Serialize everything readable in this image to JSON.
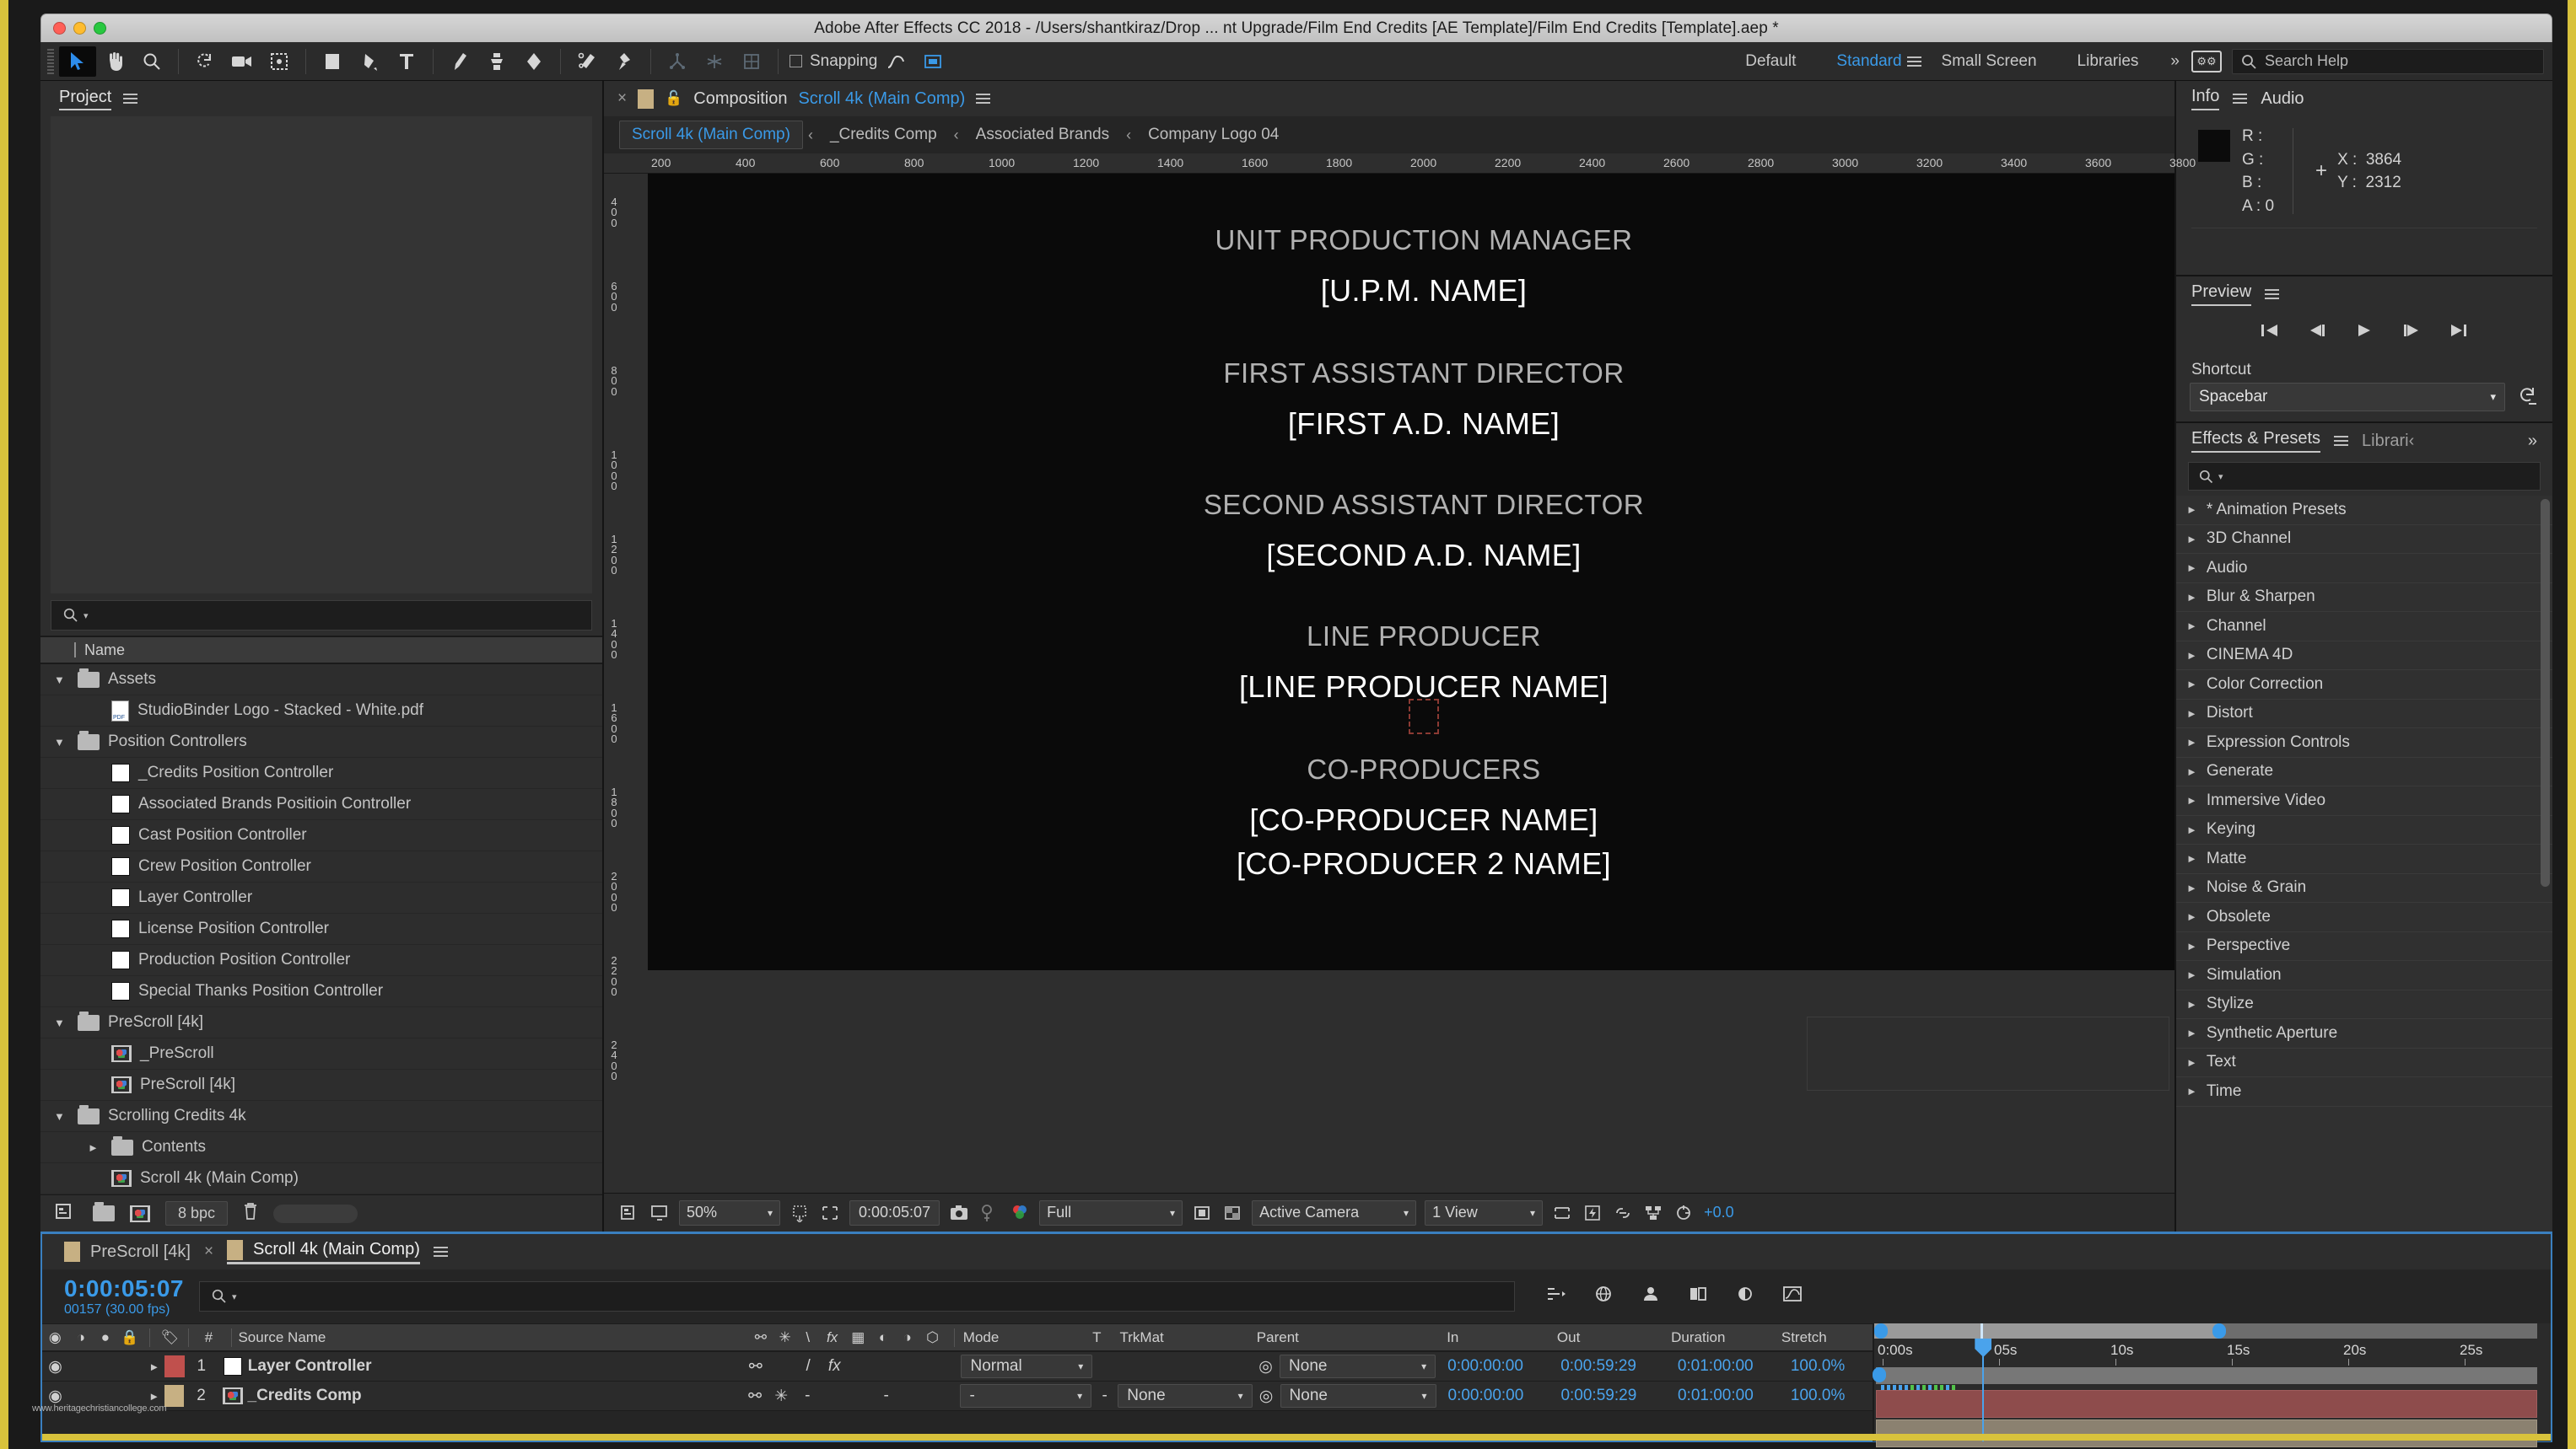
{
  "window": {
    "title": "Adobe After Effects CC 2018 - /Users/shantkiraz/Drop ... nt Upgrade/Film End Credits [AE Template]/Film End Credits [Template].aep *"
  },
  "toolbar": {
    "snapping_label": "Snapping",
    "workspaces": [
      {
        "label": "Default",
        "selected": false
      },
      {
        "label": "Standard",
        "selected": true
      },
      {
        "label": "Small Screen",
        "selected": false
      },
      {
        "label": "Libraries",
        "selected": false
      }
    ],
    "overflow": "»",
    "search_help_placeholder": "Search Help"
  },
  "project": {
    "title": "Project",
    "search_placeholder": "",
    "column_header": "Name",
    "items": [
      {
        "label": "Assets",
        "type": "folder",
        "depth": 0,
        "twirl": "down"
      },
      {
        "label": "StudioBinder Logo - Stacked - White.pdf",
        "type": "pdf",
        "depth": 1,
        "twirl": ""
      },
      {
        "label": "Position Controllers",
        "type": "folder",
        "depth": 0,
        "twirl": "down"
      },
      {
        "label": "_Credits Position Controller",
        "type": "solid",
        "depth": 1,
        "twirl": ""
      },
      {
        "label": "Associated Brands Positioin Controller",
        "type": "solid",
        "depth": 1,
        "twirl": ""
      },
      {
        "label": "Cast Position Controller",
        "type": "solid",
        "depth": 1,
        "twirl": ""
      },
      {
        "label": "Crew Position Controller",
        "type": "solid",
        "depth": 1,
        "twirl": ""
      },
      {
        "label": "Layer Controller",
        "type": "solid",
        "depth": 1,
        "twirl": ""
      },
      {
        "label": "License Position Controller",
        "type": "solid",
        "depth": 1,
        "twirl": ""
      },
      {
        "label": "Production Position Controller",
        "type": "solid",
        "depth": 1,
        "twirl": ""
      },
      {
        "label": "Special Thanks Position Controller",
        "type": "solid",
        "depth": 1,
        "twirl": ""
      },
      {
        "label": "PreScroll [4k]",
        "type": "folder",
        "depth": 0,
        "twirl": "down"
      },
      {
        "label": "_PreScroll",
        "type": "comp",
        "depth": 1,
        "twirl": ""
      },
      {
        "label": "PreScroll [4k]",
        "type": "comp",
        "depth": 1,
        "twirl": ""
      },
      {
        "label": "Scrolling Credits 4k",
        "type": "folder",
        "depth": 0,
        "twirl": "down"
      },
      {
        "label": "Contents",
        "type": "folder",
        "depth": 1,
        "twirl": "right"
      },
      {
        "label": "Scroll 4k (Main Comp)",
        "type": "comp",
        "depth": 1,
        "twirl": ""
      }
    ],
    "footer": {
      "bpc": "8 bpc"
    }
  },
  "composition": {
    "tab_label": "Composition",
    "tab_name": "Scroll 4k (Main Comp)",
    "breadcrumbs": [
      {
        "label": "Scroll 4k (Main Comp)",
        "active": true
      },
      {
        "label": "_Credits Comp",
        "active": false
      },
      {
        "label": "Associated Brands",
        "active": false
      },
      {
        "label": "Company Logo 04",
        "active": false
      }
    ],
    "ruler_h": [
      "200",
      "400",
      "600",
      "800",
      "1000",
      "1200",
      "1400",
      "1600",
      "1800",
      "2000",
      "2200",
      "2400",
      "2600",
      "2800",
      "3000",
      "3200",
      "3400",
      "3600",
      "3800"
    ],
    "ruler_v": [
      "400",
      "600",
      "800",
      "1000",
      "1200",
      "1400",
      "1600",
      "1800",
      "2000",
      "2200",
      "2400"
    ],
    "credits": [
      {
        "role": "UNIT PRODUCTION MANAGER",
        "names": [
          "[U.P.M. NAME]"
        ]
      },
      {
        "role": "FIRST ASSISTANT DIRECTOR",
        "names": [
          "[FIRST A.D. NAME]"
        ]
      },
      {
        "role": "SECOND ASSISTANT DIRECTOR",
        "names": [
          "[SECOND A.D. NAME]"
        ]
      },
      {
        "role": "LINE PRODUCER",
        "names": [
          "[LINE PRODUCER NAME]"
        ]
      },
      {
        "role": "CO-PRODUCERS",
        "names": [
          "[CO-PRODUCER NAME]",
          "[CO-PRODUCER 2 NAME]"
        ]
      }
    ],
    "footer": {
      "zoom": "50%",
      "time": "0:00:05:07",
      "resolution": "Full",
      "camera": "Active Camera",
      "views": "1 View",
      "exposure": "+0.0"
    }
  },
  "info_panel": {
    "tabs": [
      {
        "label": "Info",
        "selected": true
      },
      {
        "label": "Audio",
        "selected": false
      }
    ],
    "r_label": "R :",
    "r_value": "",
    "g_label": "G :",
    "g_value": "",
    "b_label": "B :",
    "b_value": "",
    "a_label": "A :",
    "a_value": "0",
    "x_label": "X :",
    "x_value": "3864",
    "y_label": "Y :",
    "y_value": "2312"
  },
  "preview_panel": {
    "title": "Preview",
    "shortcut_label": "Shortcut",
    "shortcut_value": "Spacebar"
  },
  "effects_panel": {
    "tabs": [
      {
        "label": "Effects & Presets",
        "selected": true
      },
      {
        "label": "Librari‹",
        "selected": false
      }
    ],
    "overflow": "»",
    "search_placeholder": "",
    "categories": [
      "* Animation Presets",
      "3D Channel",
      "Audio",
      "Blur & Sharpen",
      "Channel",
      "CINEMA 4D",
      "Color Correction",
      "Distort",
      "Expression Controls",
      "Generate",
      "Immersive Video",
      "Keying",
      "Matte",
      "Noise & Grain",
      "Obsolete",
      "Perspective",
      "Simulation",
      "Stylize",
      "Synthetic Aperture",
      "Text",
      "Time"
    ]
  },
  "timeline": {
    "tabs": [
      {
        "label": "PreScroll [4k]",
        "selected": false
      },
      {
        "label": "Scroll 4k (Main Comp)",
        "selected": true
      }
    ],
    "current_time": "0:00:05:07",
    "frame_info": "00157 (30.00 fps)",
    "search_placeholder": "",
    "columns": [
      "#",
      "Source Name",
      "Mode",
      "T",
      "TrkMat",
      "Parent",
      "In",
      "Out",
      "Duration",
      "Stretch"
    ],
    "rows": [
      {
        "index": "1",
        "source_name": "Layer Controller",
        "icon": "solid",
        "label_color": "#c0504d",
        "mode": "Normal",
        "trkmat": "",
        "parent": "None",
        "in": "0:00:00:00",
        "out": "0:00:59:29",
        "duration": "0:01:00:00",
        "stretch": "100.0%"
      },
      {
        "index": "2",
        "source_name": "_Credits Comp",
        "icon": "comp",
        "label_color": "#c7b083",
        "mode": "-",
        "trkmat": "None",
        "parent": "None",
        "in": "0:00:00:00",
        "out": "0:00:59:29",
        "duration": "0:01:00:00",
        "stretch": "100.0%"
      }
    ],
    "ruler_ticks": [
      "0:00s",
      "05s",
      "10s",
      "15s",
      "20s",
      "25s"
    ]
  },
  "watermark": "www.heritagechristiancollege.com",
  "colors": {
    "accent_blue": "#3a9ae8",
    "border_yellow": "#d8c23c",
    "panel_bg": "#2d2d2d",
    "layer_red": "#8e4c4c",
    "layer_tan": "#8b8170"
  }
}
